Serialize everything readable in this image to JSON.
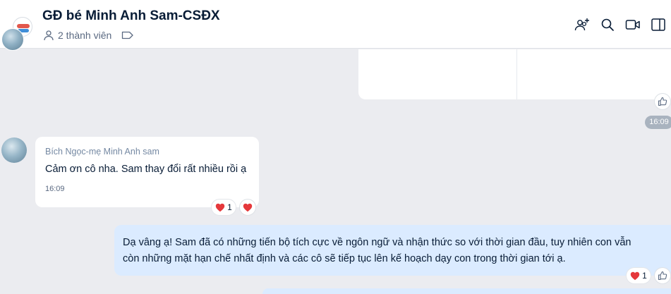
{
  "header": {
    "title": "GĐ bé Minh Anh Sam-CSĐX",
    "member_count": "2 thành viên"
  },
  "toolbar": {
    "icons": [
      "add-member-icon",
      "search-icon",
      "video-call-icon",
      "sidebar-toggle-icon"
    ]
  },
  "messages": {
    "top_time": "16:09",
    "incoming": {
      "sender": "Bích Ngọc-mẹ Minh Anh sam",
      "text": "Cảm ơn cô nha. Sam thay đổi rất nhiều rồi ạ",
      "time": "16:09",
      "reaction_count": "1"
    },
    "outgoing": {
      "line1": "Dạ vâng ạ! Sam đã có  những tiến bộ tích cực về ngôn ngữ và nhận thức so với thời gian đầu, tuy nhiên con vẫn",
      "line2": "còn những mặt hạn chế nhất định và các cô sẽ tiếp tục lên kế hoạch dạy con trong thời gian tới ạ.",
      "reaction_count": "1"
    }
  },
  "colors": {
    "chat_background": "#ebecf0",
    "outgoing_bubble": "#dbebff",
    "heart": "#e5383b",
    "time_pill": "#a9b3bf"
  }
}
